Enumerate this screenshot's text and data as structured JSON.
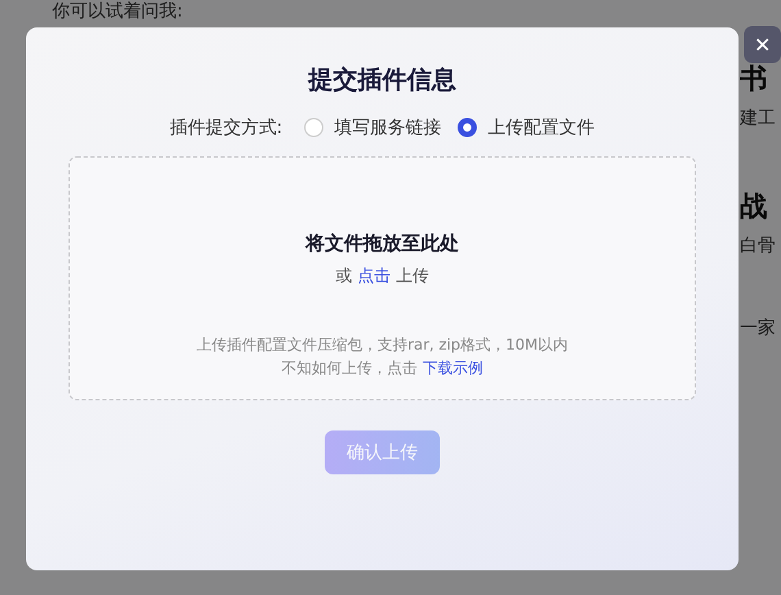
{
  "background_page": {
    "prompt_heading": "你可以试着问我:",
    "side_fragments": [
      {
        "text": "书",
        "kind": "heading"
      },
      {
        "text": "建工",
        "kind": "body"
      },
      {
        "text": "战",
        "kind": "heading"
      },
      {
        "text": "白骨",
        "kind": "body"
      },
      {
        "text": "一家",
        "kind": "body"
      }
    ]
  },
  "dialog": {
    "title": "提交插件信息",
    "method_label": "插件提交方式:",
    "options": [
      {
        "label": "填写服务链接",
        "selected": false
      },
      {
        "label": "上传配置文件",
        "selected": true
      }
    ],
    "dropzone": {
      "title": "将文件拖放至此处",
      "or": "或",
      "click_link": "点击",
      "upload": "上传",
      "hint": "上传插件配置文件压缩包，支持rar, zip格式，10M以内",
      "help_prefix": "不知如何上传，点击",
      "help_link": "下载示例"
    },
    "submit": {
      "label": "确认上传",
      "disabled": true
    },
    "close": "✕"
  }
}
